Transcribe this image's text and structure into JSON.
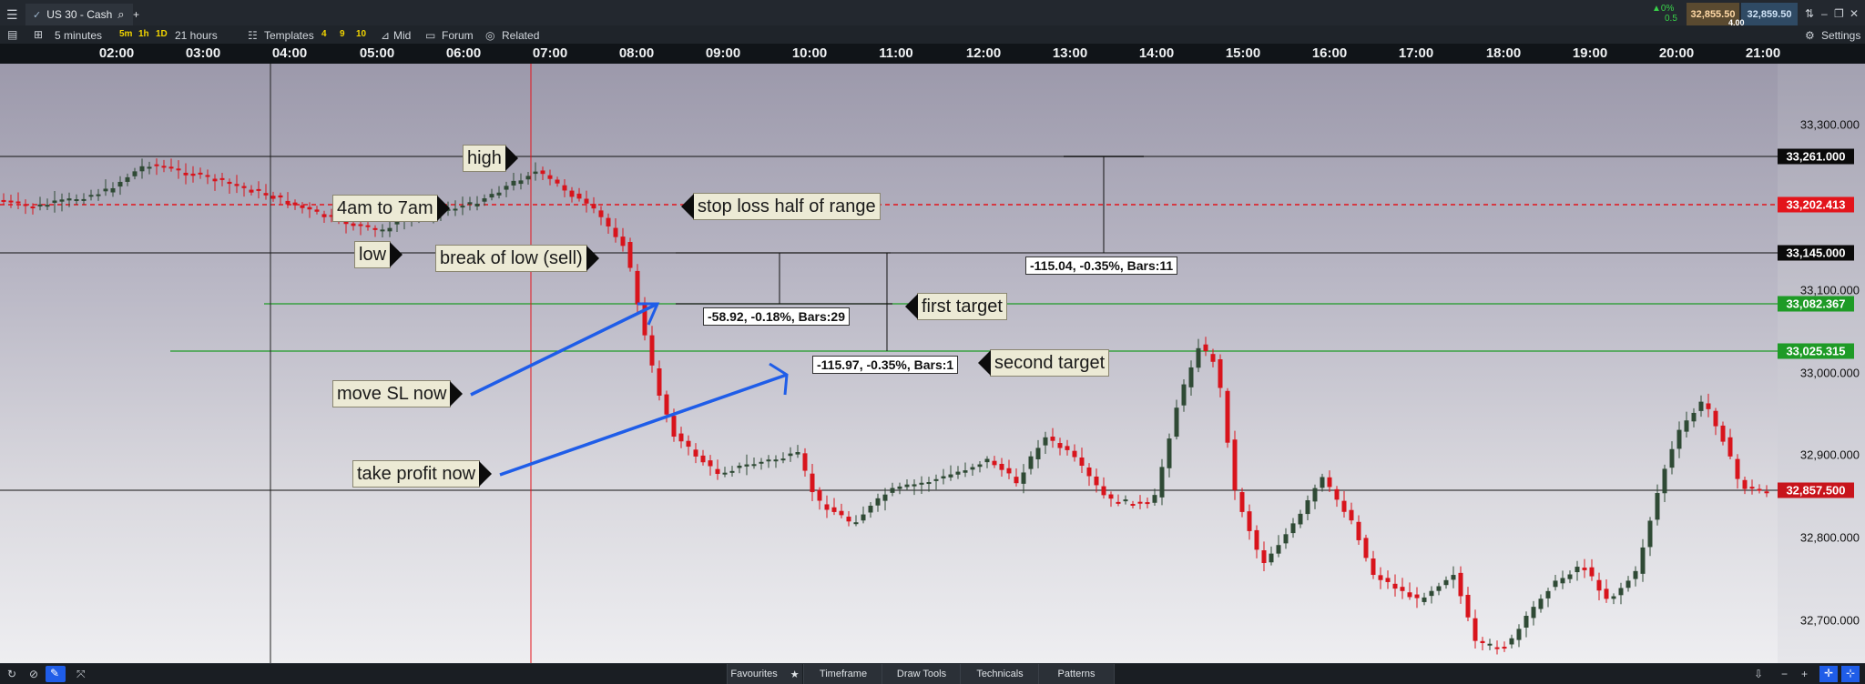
{
  "tabbar": {
    "tab_title": "US 30 - Cash",
    "add_tab": "+",
    "change_pct": "▲0%",
    "change_val": "0.5",
    "sell_price": "32,855.50",
    "buy_price": "32,859.50",
    "spread": "4.00"
  },
  "toolbar": {
    "interval": "5 minutes",
    "tf_5m": "5m",
    "tf_1h": "1h",
    "tf_1d": "1D",
    "span": "21 hours",
    "templates": "Templates",
    "t4": "4",
    "t9": "9",
    "t10": "10",
    "mid": "Mid",
    "forum": "Forum",
    "related": "Related",
    "settings": "Settings"
  },
  "time_labels": [
    "02:00",
    "03:00",
    "04:00",
    "05:00",
    "06:00",
    "07:00",
    "08:00",
    "09:00",
    "10:00",
    "11:00",
    "12:00",
    "13:00",
    "14:00",
    "15:00",
    "16:00",
    "17:00",
    "18:00",
    "19:00",
    "20:00",
    "21:00"
  ],
  "price_ticks": [
    "33,300.000",
    "33,100.000",
    "33,000.000",
    "32,900.000",
    "32,800.000",
    "32,700.000"
  ],
  "price_tags": {
    "high": "33,261.000",
    "stop": "33,202.413",
    "low": "33,145.000",
    "first": "33,082.367",
    "second": "33,025.315",
    "last": "32,857.500"
  },
  "annotations": {
    "high": "high",
    "range": "4am to 7am",
    "low": "low",
    "break": "break of low (sell)",
    "stop": "stop loss half of range",
    "first": "first target",
    "second": "second target",
    "move_sl": "move SL now",
    "take_profit": "take profit now"
  },
  "measurements": {
    "m1": "-115.04, -0.35%, Bars:11",
    "m2": "-58.92, -0.18%, Bars:29",
    "m3": "-115.97, -0.35%, Bars:1"
  },
  "bottombar": {
    "favourites": "Favourites",
    "timeframe": "Timeframe",
    "draw_tools": "Draw Tools",
    "technicals": "Technicals",
    "patterns": "Patterns"
  },
  "colors": {
    "up": "#2f4a35",
    "down": "#d8141c",
    "accent_green": "#1e9b26",
    "accent_red": "#e3141b",
    "arrow_blue": "#1f5de8"
  }
}
